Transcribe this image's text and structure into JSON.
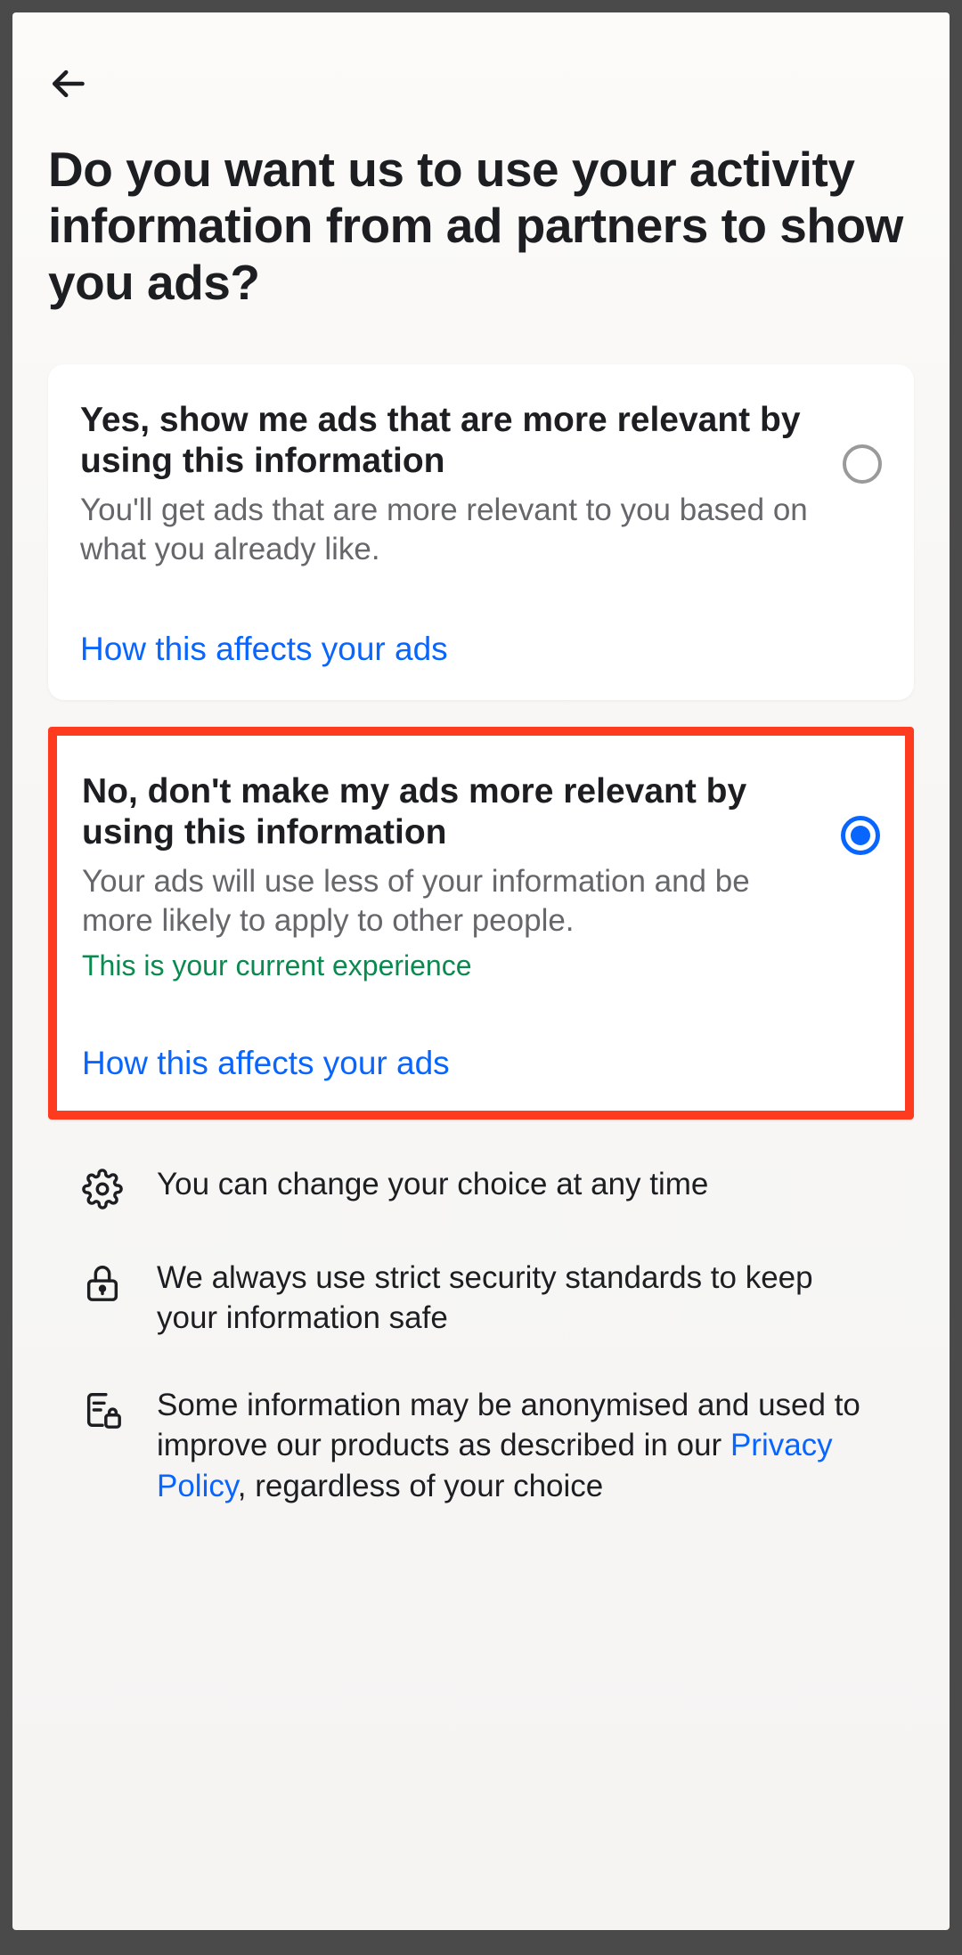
{
  "header": {
    "title": "Do you want us to use your activity information from ad partners to show you ads?"
  },
  "options": {
    "yes": {
      "title": "Yes, show me ads that are more relevant by using this information",
      "description": "You'll get ads that are more relevant to you based on what you already like.",
      "affects_link": "How this affects your ads",
      "selected": false
    },
    "no": {
      "title": "No, don't make my ads more relevant by using this information",
      "description": "Your ads will use less of your information and be more likely to apply to other people.",
      "current_notice": "This is your current experience",
      "affects_link": "How this affects your ads",
      "selected": true
    }
  },
  "info": {
    "change": "You can change your choice at any time",
    "security": "We always use strict security standards to keep your information safe",
    "anonymised_pre": "Some information may be anonymised and used to improve our products as described in our ",
    "privacy_policy_label": "Privacy Policy",
    "anonymised_post": ", regardless of your choice"
  }
}
